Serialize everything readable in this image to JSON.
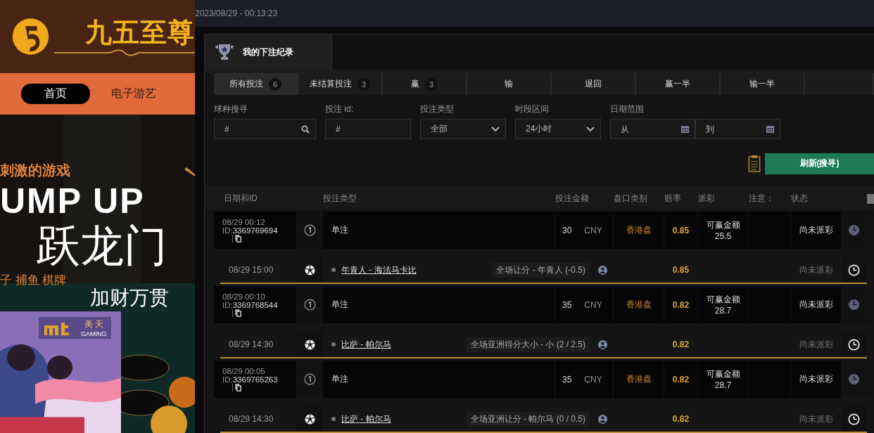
{
  "site": {
    "logo_text": "九五至尊",
    "nav": [
      {
        "label": "首页",
        "selected": true
      },
      {
        "label": "电子游艺",
        "selected": false
      }
    ],
    "banner": {
      "kind": "picture",
      "lines": [
        "刺激的游戏",
        "UMP UP",
        "跃龙门",
        "子  捕鱼  棋牌",
        "加财万贯"
      ]
    },
    "popup": {
      "kind": "picture",
      "brand": "美 天",
      "brand_sub": "GAMING"
    }
  },
  "clock": "2023/08/29 - 00:13:23",
  "panel": {
    "title": "我的下注纪录",
    "tabs": [
      {
        "label": "所有投注",
        "count": "6",
        "selected": true
      },
      {
        "label": "未结算投注",
        "count": "3",
        "selected": false
      },
      {
        "label": "赢",
        "count": "3",
        "selected": false
      },
      {
        "label": "输",
        "selected": false
      },
      {
        "label": "退回",
        "selected": false
      },
      {
        "label": "赢一半",
        "selected": false
      },
      {
        "label": "输一半",
        "selected": false
      }
    ],
    "filters": [
      {
        "label": "球种搜寻",
        "kind": "search",
        "placeholder": "#"
      },
      {
        "label": "投注 id:",
        "kind": "text",
        "placeholder": "#"
      },
      {
        "label": "投注类型",
        "kind": "select",
        "value": "全部"
      },
      {
        "label": "时段区间",
        "kind": "select",
        "value": "24小时"
      },
      {
        "label": "日期范围",
        "kind": "daterange",
        "placeholder_from": "从",
        "placeholder_to": "到"
      }
    ],
    "refresh_button": "刷新(搜寻)",
    "columns": [
      "日期和ID",
      "投注类型",
      "投注金额",
      "盘口类别",
      "赔率",
      "派彩",
      "注意：",
      "状态"
    ],
    "bets": [
      {
        "date": "08/29 00:12",
        "id_label": "ID:",
        "id": "3369769694",
        "type": "单注",
        "amount": "30",
        "currency": "CNY",
        "market": "香港盘",
        "odds": "0.85",
        "payout_label": "可赢金额",
        "payout": "25.5",
        "status": "尚未派彩",
        "detail": {
          "time": "08/29 15:00",
          "match": "年青人 - 海法马卡比",
          "selection": "全场让分 - 年青人 (-0.5)",
          "odds": "0.85",
          "status": "尚未派彩"
        }
      },
      {
        "date": "08/29 00:10",
        "id_label": "ID:",
        "id": "3369768544",
        "type": "单注",
        "amount": "35",
        "currency": "CNY",
        "market": "香港盘",
        "odds": "0.82",
        "payout_label": "可赢金额",
        "payout": "28.7",
        "status": "尚未派彩",
        "detail": {
          "time": "08/29 14:30",
          "match": "比萨 - 帕尔马",
          "selection": "全场亚洲得分大小 - 小 (2 / 2.5)",
          "odds": "0.82",
          "status": "尚未派彩"
        }
      },
      {
        "date": "08/29 00:05",
        "id_label": "ID:",
        "id": "3369765263",
        "type": "单注",
        "amount": "35",
        "currency": "CNY",
        "market": "香港盘",
        "odds": "0.82",
        "payout_label": "可赢金额",
        "payout": "28.7",
        "status": "尚未派彩",
        "detail": {
          "time": "08/29 14:30",
          "match": "比萨 - 帕尔马",
          "selection": "全场亚洲让分 - 帕尔马 (0 / 0.5)",
          "odds": "0.82",
          "status": "尚未派彩"
        }
      }
    ]
  }
}
